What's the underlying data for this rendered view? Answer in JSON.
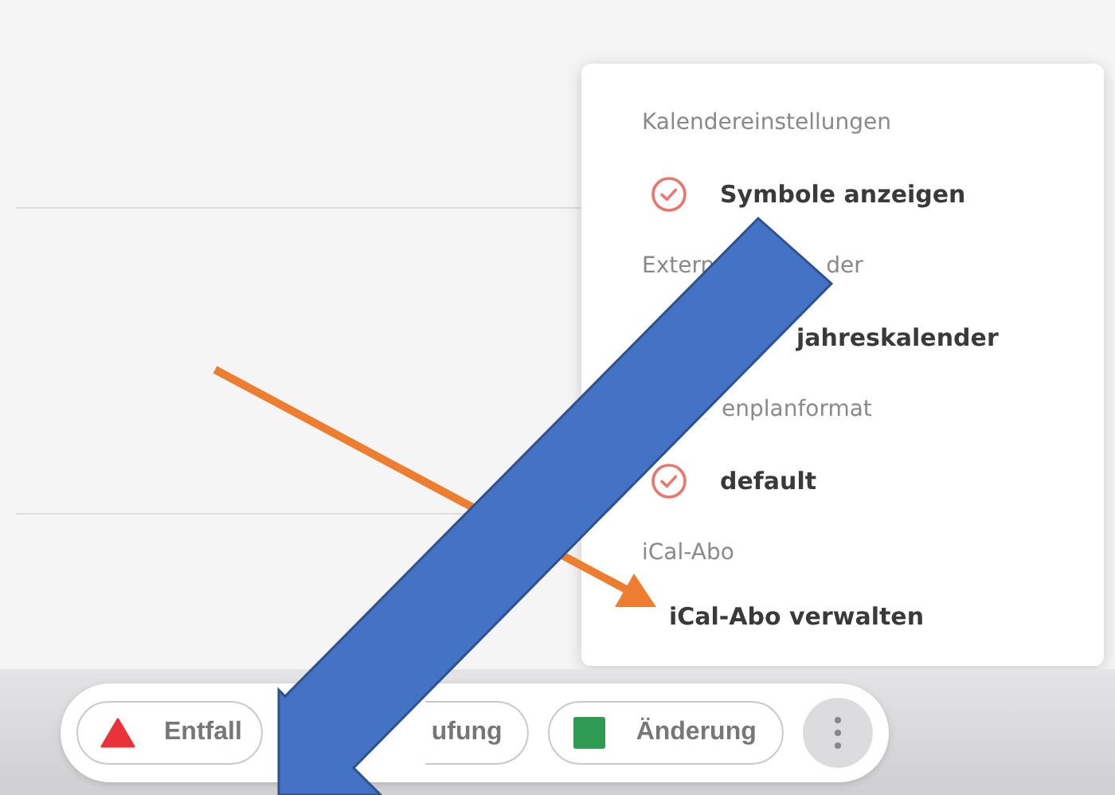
{
  "menu": {
    "sections": [
      {
        "heading_parts": [
          "Kalendereinstellungen"
        ],
        "items": [
          {
            "kind": "check",
            "label": "Symbole anzeigen",
            "checked": true
          }
        ]
      },
      {
        "heading_parts": [
          "Extern",
          "der"
        ],
        "items": [
          {
            "kind": "covered",
            "label": "jahreskalender"
          }
        ]
      },
      {
        "heading_parts": [
          "enplanformat"
        ],
        "items": [
          {
            "kind": "check",
            "label": "default",
            "checked": true
          }
        ]
      },
      {
        "heading_parts": [
          "iCal-Abo"
        ],
        "items": [
          {
            "kind": "link",
            "label": "iCal-Abo verwalten"
          }
        ]
      }
    ]
  },
  "legend": [
    {
      "kind": "triangle",
      "label": "Entfall",
      "color": "#e8333a"
    },
    {
      "kind": "covered",
      "label": "ufung"
    },
    {
      "kind": "square",
      "label": "Änderung",
      "color": "#2e9a52"
    }
  ],
  "annotations": [
    {
      "kind": "thin-arrow",
      "color": "#ed7d31"
    },
    {
      "kind": "block-arrow",
      "color": "#4472c4"
    }
  ]
}
